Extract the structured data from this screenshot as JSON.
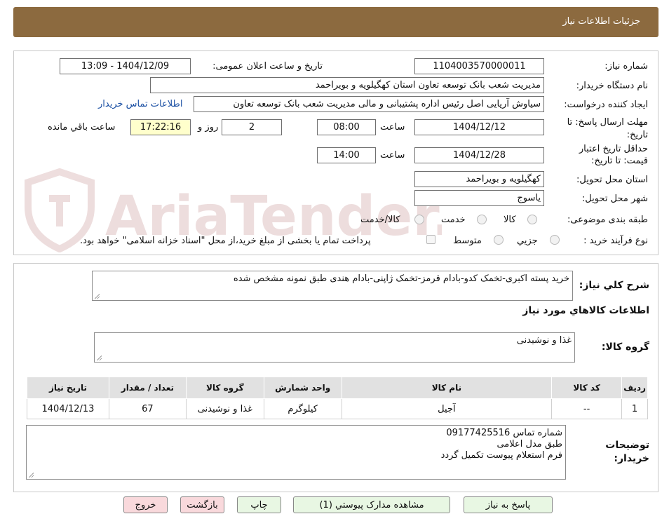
{
  "header": {
    "title": "جزئیات اطلاعات نیاز"
  },
  "fields": {
    "need_number": {
      "label": "شماره نیاز:",
      "value": "1104003570000011"
    },
    "announce": {
      "label": "تاریخ و ساعت اعلان عمومی:",
      "value": "1404/12/09 - 13:09"
    },
    "buyer_org": {
      "label": "نام دستگاه خریدار:",
      "value": "مدیریت شعب بانک توسعه تعاون استان کهگیلویه و بویراحمد"
    },
    "requester": {
      "label": "ایجاد کننده درخواست:",
      "value": "سیاوش آریایی اصل رئیس اداره پشتیبانی و مالی مدیریت شعب بانک توسعه تعاون",
      "contact_link": "اطلاعات تماس خریدار"
    },
    "response_deadline": {
      "label_line1": "مهلت ارسال پاسخ: تا",
      "label_line2": "تاریخ:",
      "date": "1404/12/12",
      "time_label": "ساعت",
      "time": "08:00",
      "days": "2",
      "days_label": "روز و",
      "remaining": "17:22:16",
      "remaining_label": "ساعت باقي مانده"
    },
    "price_validity": {
      "label_line1": "حداقل تاریخ اعتبار",
      "label_line2": "قیمت: تا تاریخ:",
      "date": "1404/12/28",
      "time_label": "ساعت",
      "time": "14:00"
    },
    "delivery_province": {
      "label": "استان محل تحویل:",
      "value": "کهگیلویه و بویراحمد"
    },
    "delivery_city": {
      "label": "شهر محل تحویل:",
      "value": "یاسوج"
    },
    "category": {
      "label": "طبقه بندی موضوعی:",
      "options": [
        "کالا",
        "خدمت",
        "کالا/خدمت"
      ]
    },
    "purchase_type": {
      "label": "نوع فرآیند خرید :",
      "options": [
        "جزیي",
        "متوسط"
      ],
      "treasury_note": "پرداخت تمام یا بخشی از مبلغ خرید،از محل \"اسناد خزانه اسلامی\" خواهد بود."
    }
  },
  "summary": {
    "label": "شرح کلي نياز:",
    "value": "خرید پسته اکبری-تخمک کدو-بادام قرمز-تخمک ژاپنی-بادام هندی طبق نمونه مشخص شده"
  },
  "goods_section": {
    "title": "اطلاعات کالاهاي مورد نياز",
    "group_label": "گروه کالا:",
    "group_value": "غذا و نوشیدنی"
  },
  "table": {
    "headers": [
      "رديف",
      "کد کالا",
      "نام کالا",
      "واحد شمارش",
      "گروه کالا",
      "تعداد / مقدار",
      "تاريخ نياز"
    ],
    "rows": [
      [
        "1",
        "--",
        "آجیل",
        "کیلوگرم",
        "غذا و نوشیدنی",
        "67",
        "1404/12/13"
      ]
    ]
  },
  "buyer_notes": {
    "label_line1": "توضیحات",
    "label_line2": "خریدار:",
    "lines": [
      "شماره تماس 09177425516",
      "طبق مدل اعلامی",
      "فرم استعلام پیوست تکمیل گردد"
    ]
  },
  "buttons": {
    "respond": "پاسخ به نياز",
    "view_docs": "مشاهده مدارک پيوستي (1)",
    "print": "چاپ",
    "back": "بازگشت",
    "exit": "خروج"
  },
  "watermark": {
    "brand": "AriaTender.net"
  },
  "colors": {
    "header_bg": "#8c6a3f",
    "remaining_bg": "#ffffcc",
    "green_button": "#e8f7e3",
    "pink_button": "#f9d9dc",
    "link": "#1a4fa3"
  }
}
